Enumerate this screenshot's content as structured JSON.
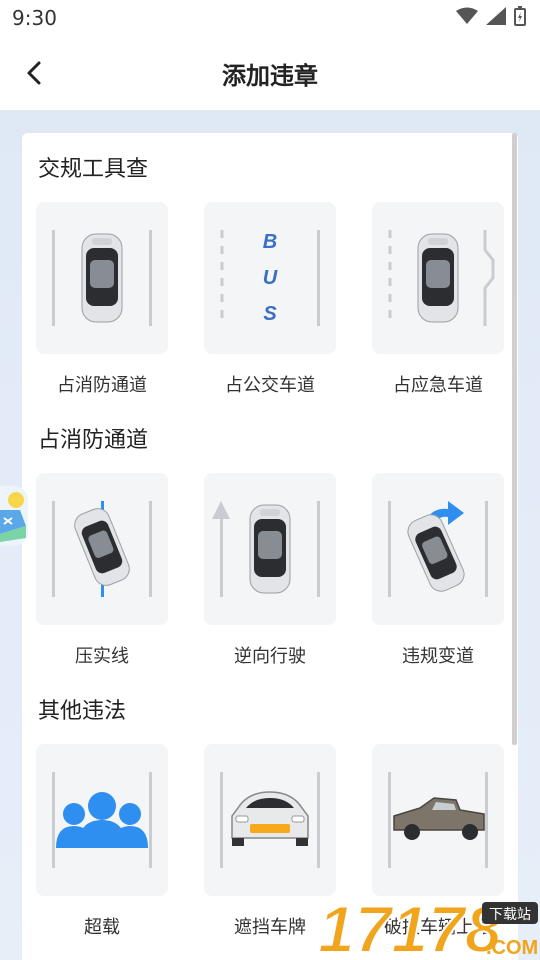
{
  "status_bar": {
    "time": "9:30"
  },
  "header": {
    "title": "添加违章"
  },
  "sections": [
    {
      "title": "交规工具查",
      "items": [
        {
          "label": "占消防通道",
          "icon": "car-in-lane-icon"
        },
        {
          "label": "占公交车道",
          "icon": "bus-lane-icon",
          "lane_text": [
            "B",
            "U",
            "S"
          ]
        },
        {
          "label": "占应急车道",
          "icon": "emergency-lane-icon"
        }
      ]
    },
    {
      "title": "占消防通道",
      "items": [
        {
          "label": "压实线",
          "icon": "crossing-solid-line-icon"
        },
        {
          "label": "逆向行驶",
          "icon": "wrong-way-driving-icon"
        },
        {
          "label": "违规变道",
          "icon": "illegal-lane-change-icon"
        }
      ]
    },
    {
      "title": "其他违法",
      "items": [
        {
          "label": "超载",
          "icon": "overload-people-icon"
        },
        {
          "label": "遮挡车牌",
          "icon": "covered-license-plate-icon"
        },
        {
          "label": "破损车辆上路",
          "icon": "damaged-truck-icon"
        }
      ]
    }
  ],
  "watermark": {
    "text": "17178",
    "suffix": ".COM",
    "badge": "下载站"
  },
  "colors": {
    "accent_blue": "#2f8ff0",
    "tile_bg": "#f3f5f7",
    "page_bg": "#e3ecf7"
  }
}
